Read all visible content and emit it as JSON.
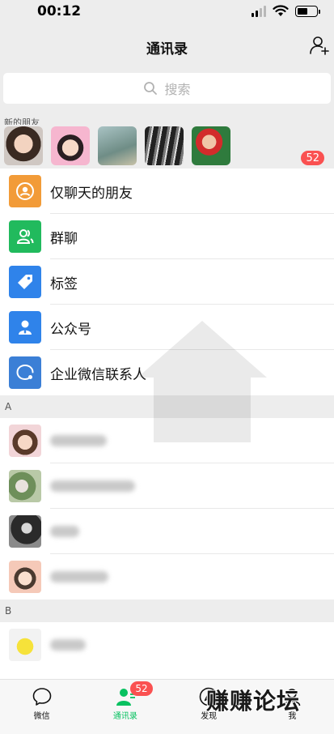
{
  "status": {
    "time": "00:12"
  },
  "header": {
    "title": "通讯录"
  },
  "search": {
    "placeholder": "搜索"
  },
  "new_friends": {
    "label": "新的朋友",
    "badge": "52"
  },
  "functions": [
    {
      "label": "仅聊天的朋友",
      "icon": "person-chat-icon",
      "color": "#f29b38"
    },
    {
      "label": "群聊",
      "icon": "group-chat-icon",
      "color": "#21ba5d"
    },
    {
      "label": "标签",
      "icon": "tag-icon",
      "color": "#2f83ea"
    },
    {
      "label": "公众号",
      "icon": "official-account-icon",
      "color": "#2f83ea"
    },
    {
      "label": "企业微信联系人",
      "icon": "enterprise-contact-icon",
      "color": "#3b7fd6"
    }
  ],
  "sections": [
    {
      "letter": "A"
    },
    {
      "letter": "B"
    }
  ],
  "tabs": [
    {
      "label": "微信",
      "icon": "chat-bubble-icon"
    },
    {
      "label": "通讯录",
      "icon": "contacts-icon",
      "badge": "52"
    },
    {
      "label": "发现",
      "icon": "compass-icon"
    },
    {
      "label": "我",
      "icon": "person-icon"
    }
  ],
  "watermark": {
    "text": "赚赚论坛"
  },
  "colors": {
    "accent": "#07c160",
    "badge": "#fa5151"
  }
}
